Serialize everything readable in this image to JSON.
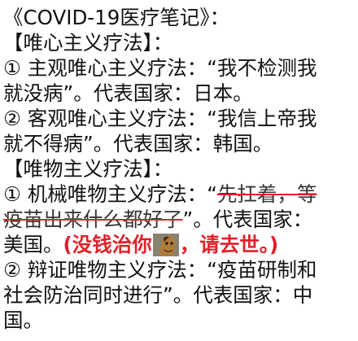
{
  "document": {
    "title": "《COVID-19医疗笔记》：",
    "sections": [
      {
        "header": "【唯心主义疗法】：",
        "items": [
          {
            "line1": "① 主观唯心主义疗法：“我不检测我",
            "line2": "就没病”。代表国家：日本。"
          },
          {
            "line1": "② 客观唯心主义疗法：“我信上帝我",
            "line2": "就不得病”。代表国家：韩国。"
          }
        ]
      },
      {
        "header": "【唯物主义疗法】：",
        "item1": {
          "prefix": "① 机械唯物主义疗法：“",
          "struck_a": "先扛着，等",
          "struck_b": "疫苗出来什么都好了",
          "suffix_b": "”。代表国家：",
          "country": "美国。",
          "note_before_icon": "(没钱治你",
          "icon": "horse-emoji",
          "note_after_icon": "，请去世。)"
        },
        "item2": {
          "line1": "② 辩证唯物主义疗法：“疫苗研制和",
          "line2": "社会防治同时进行”。代表国家：中",
          "line3": "国。"
        }
      }
    ],
    "colors": {
      "text": "#111111",
      "red": "#e0202a",
      "background": "#ffffff"
    }
  }
}
